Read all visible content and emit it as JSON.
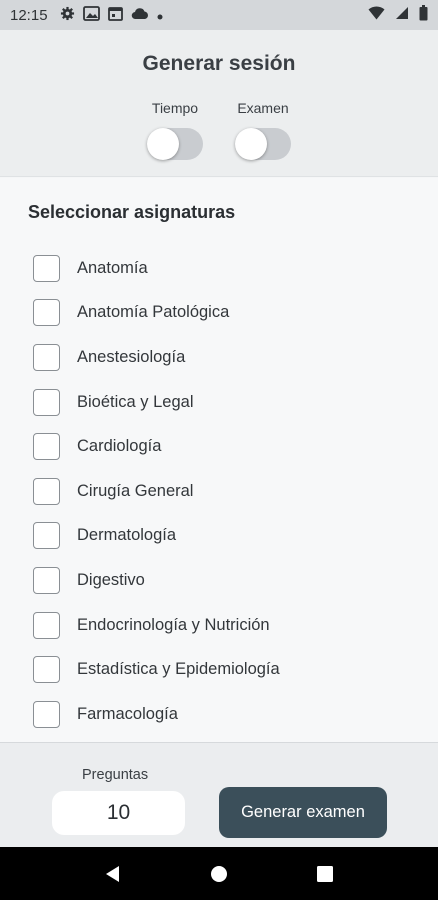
{
  "status_bar": {
    "time": "12:15",
    "left_icons": [
      "gear-icon",
      "image-icon",
      "calendar-icon",
      "cloud-icon",
      "dot-icon"
    ],
    "right_icons": [
      "wifi-icon",
      "signal-icon",
      "battery-icon"
    ]
  },
  "header": {
    "title": "Generar sesión",
    "toggles": [
      {
        "label": "Tiempo",
        "on": false
      },
      {
        "label": "Examen",
        "on": false
      }
    ]
  },
  "subjects": {
    "heading": "Seleccionar asignaturas",
    "items": [
      {
        "label": "Anatomía",
        "checked": false
      },
      {
        "label": "Anatomía Patológica",
        "checked": false
      },
      {
        "label": "Anestesiología",
        "checked": false
      },
      {
        "label": "Bioética y Legal",
        "checked": false
      },
      {
        "label": "Cardiología",
        "checked": false
      },
      {
        "label": "Cirugía General",
        "checked": false
      },
      {
        "label": "Dermatología",
        "checked": false
      },
      {
        "label": "Digestivo",
        "checked": false
      },
      {
        "label": "Endocrinología y Nutrición",
        "checked": false
      },
      {
        "label": "Estadística y Epidemiología",
        "checked": false
      },
      {
        "label": "Farmacología",
        "checked": false
      }
    ]
  },
  "footer": {
    "questions_label": "Preguntas",
    "questions_value": "10",
    "generate_label": "Generar examen"
  },
  "colors": {
    "accent_button": "#3b4f5a",
    "header_bg": "#eceeef",
    "toggle_off": "#c9ccd0"
  },
  "nav_bar": [
    "back-icon",
    "home-icon",
    "recents-icon"
  ]
}
